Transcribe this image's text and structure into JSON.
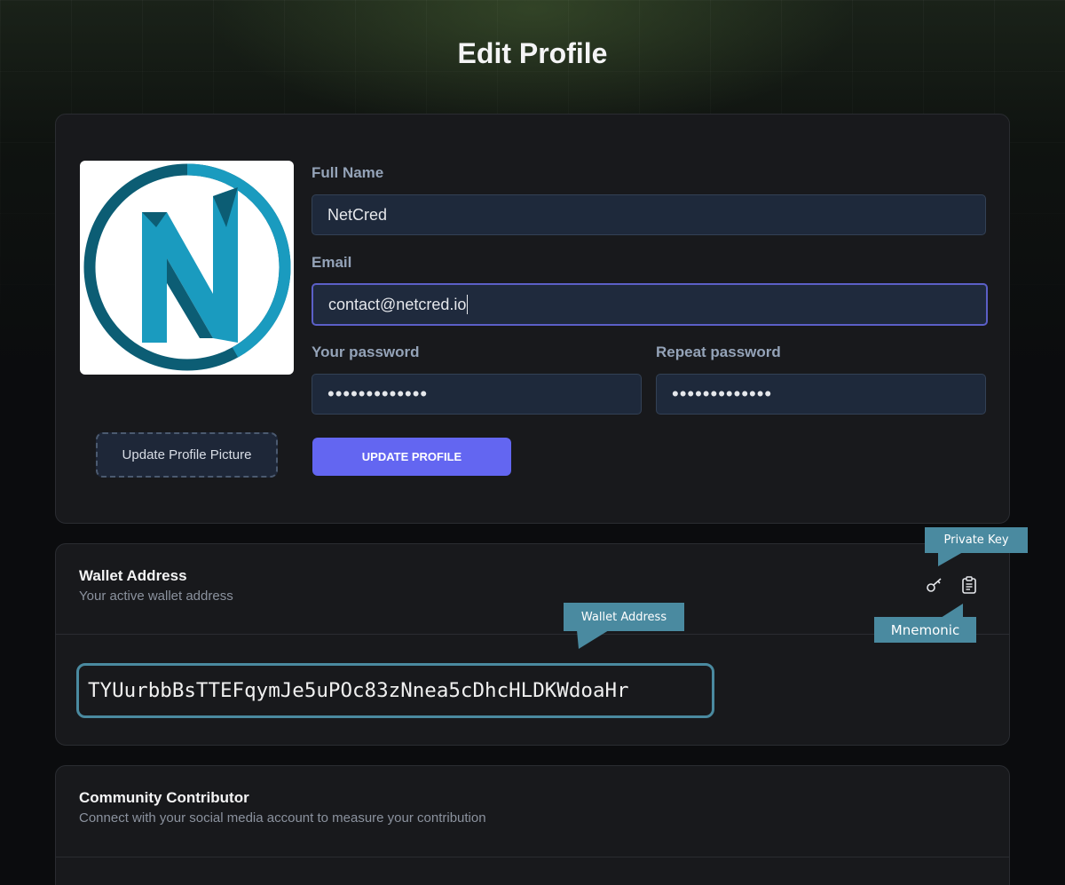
{
  "page": {
    "title": "Edit Profile"
  },
  "profile": {
    "avatar_alt": "NetCred logo",
    "update_picture_label": "Update Profile Picture",
    "full_name": {
      "label": "Full Name",
      "value": "NetCred"
    },
    "email": {
      "label": "Email",
      "value": "contact@netcred.io"
    },
    "password": {
      "label": "Your password",
      "value": "•••••••••••••"
    },
    "repeat_password": {
      "label": "Repeat password",
      "value": "•••••••••••••"
    },
    "submit_label": "UPDATE PROFILE"
  },
  "wallet": {
    "title": "Wallet Address",
    "subtitle": "Your active wallet address",
    "address": "TYUurbbBsTTEFqymJe5uPOc83zNnea5cDhcHLDKWdoaHr",
    "icons": {
      "private_key": "key-icon",
      "mnemonic": "clipboard-icon"
    }
  },
  "callouts": {
    "private_key": "Private Key",
    "wallet_address": "Wallet Address",
    "mnemonic": "Mnemonic"
  },
  "community": {
    "title": "Community Contributor",
    "subtitle": "Connect with your social media account to measure your contribution"
  },
  "colors": {
    "accent": "#6366f1",
    "callout": "#4a8aa0",
    "logo_primary": "#1a9bbf",
    "logo_dark": "#0c5d74"
  }
}
